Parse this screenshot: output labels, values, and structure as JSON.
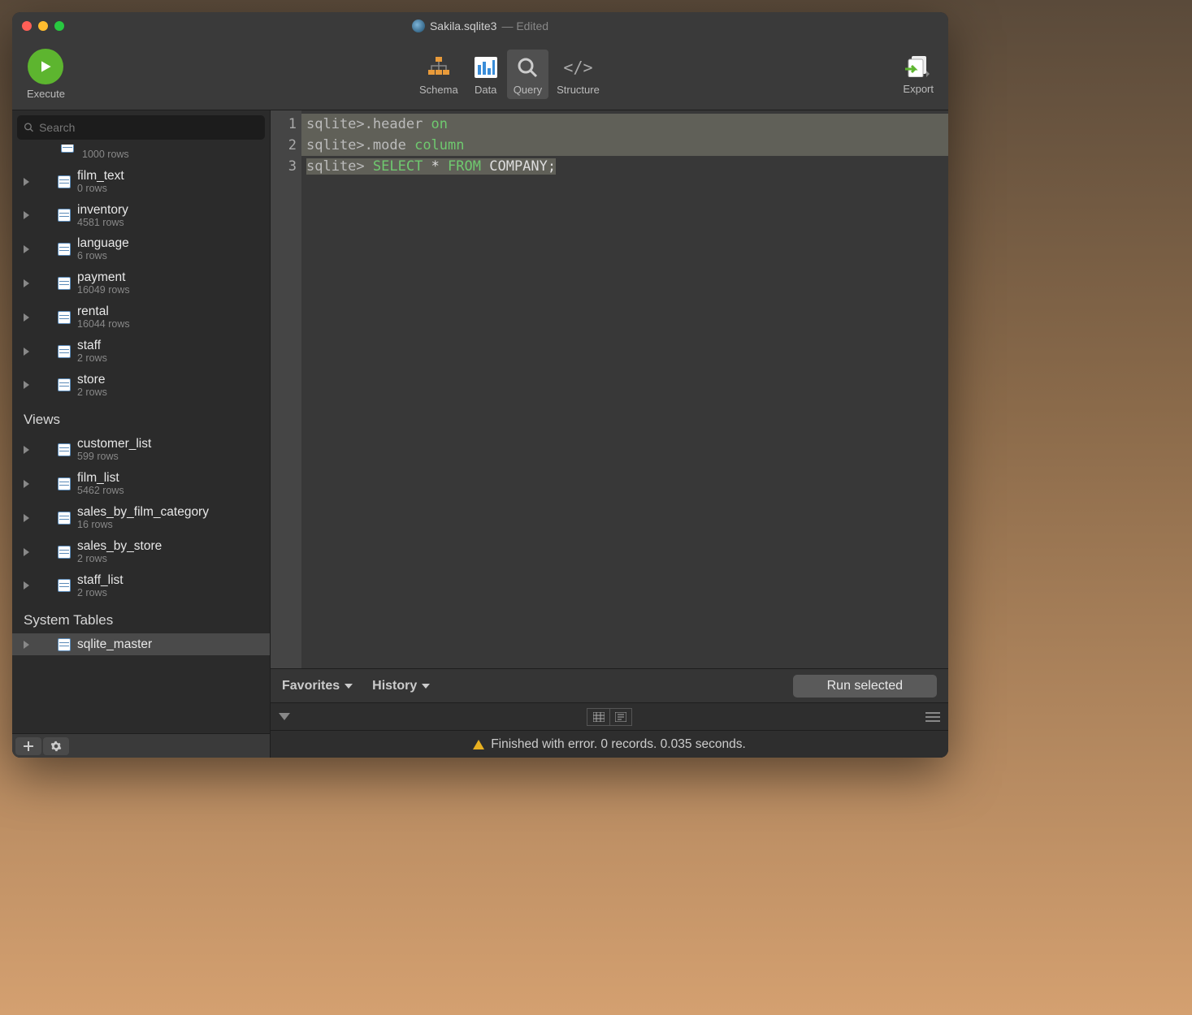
{
  "titlebar": {
    "filename": "Sakila.sqlite3",
    "edited": "— Edited"
  },
  "toolbar": {
    "execute": "Execute",
    "schema": "Schema",
    "data": "Data",
    "query": "Query",
    "structure": "Structure",
    "export": "Export"
  },
  "sidebar": {
    "search_placeholder": "Search",
    "first_rows": "1000 rows",
    "tables": [
      {
        "name": "film_text",
        "rows": "0 rows"
      },
      {
        "name": "inventory",
        "rows": "4581 rows"
      },
      {
        "name": "language",
        "rows": "6 rows"
      },
      {
        "name": "payment",
        "rows": "16049 rows"
      },
      {
        "name": "rental",
        "rows": "16044 rows"
      },
      {
        "name": "staff",
        "rows": "2 rows"
      },
      {
        "name": "store",
        "rows": "2 rows"
      }
    ],
    "views_header": "Views",
    "views": [
      {
        "name": "customer_list",
        "rows": "599 rows"
      },
      {
        "name": "film_list",
        "rows": "5462 rows"
      },
      {
        "name": "sales_by_film_category",
        "rows": "16 rows"
      },
      {
        "name": "sales_by_store",
        "rows": "2 rows"
      },
      {
        "name": "staff_list",
        "rows": "2 rows"
      }
    ],
    "system_header": "System Tables",
    "system": [
      {
        "name": "sqlite_master"
      }
    ]
  },
  "editor": {
    "lines": [
      {
        "n": "1",
        "prompt": "sqlite>",
        "cmd": ".header ",
        "kw": "on"
      },
      {
        "n": "2",
        "prompt": "sqlite>",
        "cmd": ".mode ",
        "kw": "column"
      },
      {
        "n": "3",
        "prompt": "sqlite>",
        "cmd": " ",
        "kw": "SELECT",
        "mid": " * ",
        "kw2": "FROM",
        "tail": " COMPANY;"
      }
    ]
  },
  "bar1": {
    "favorites": "Favorites",
    "history": "History",
    "run": "Run selected"
  },
  "status": {
    "text": "Finished with error. 0 records. 0.035 seconds."
  }
}
